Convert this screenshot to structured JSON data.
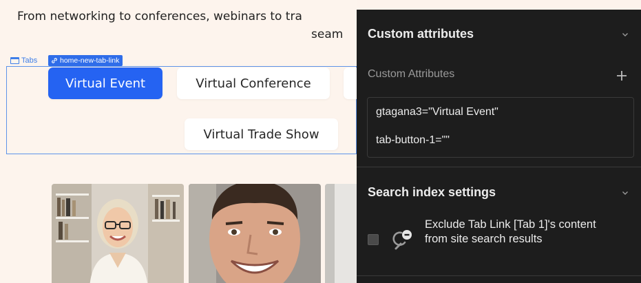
{
  "canvas": {
    "intro_line1": "From networking to conferences, webinars to tra",
    "intro_line2": "seam",
    "tabs_element_label": "Tabs",
    "selected_element_badge": "home-new-tab-link",
    "tabs": [
      {
        "label": "Virtual Event",
        "active": true
      },
      {
        "label": "Virtual Conference",
        "active": false
      },
      {
        "label": "",
        "active": false
      },
      {
        "label": "Virtual Trade Show",
        "active": false
      }
    ],
    "accent_color": "#2563f2"
  },
  "panel": {
    "custom_attributes": {
      "section_title": "Custom attributes",
      "list_label": "Custom Attributes",
      "add_icon": "plus-icon",
      "attributes": [
        {
          "text": "gtagana3=\"Virtual Event\""
        },
        {
          "text": "tab-button-1=\"\""
        }
      ]
    },
    "search_index": {
      "section_title": "Search index settings",
      "exclude_text": "Exclude Tab Link [Tab 1]'s content from site search results",
      "exclude_checked": false,
      "icon": "search-exclude-icon"
    },
    "background_color": "#1d1d1d"
  }
}
